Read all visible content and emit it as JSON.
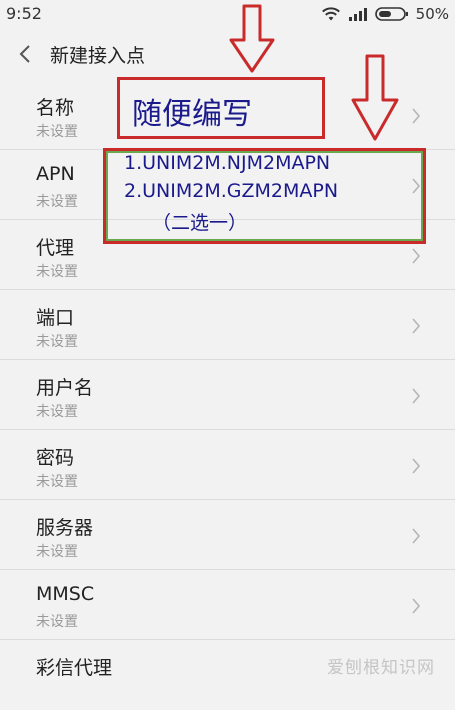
{
  "status_bar": {
    "time": "9:52",
    "battery": "50%",
    "icons": [
      "wifi-icon",
      "signal-icon",
      "battery-icon"
    ]
  },
  "app_bar": {
    "back_icon": "chevron-left-icon",
    "title": "新建接入点"
  },
  "list": {
    "items": [
      {
        "title": "名称",
        "subtitle": "未设置"
      },
      {
        "title": "APN",
        "subtitle": "未设置"
      },
      {
        "title": "代理",
        "subtitle": "未设置"
      },
      {
        "title": "端口",
        "subtitle": "未设置"
      },
      {
        "title": "用户名",
        "subtitle": "未设置"
      },
      {
        "title": "密码",
        "subtitle": "未设置"
      },
      {
        "title": "服务器",
        "subtitle": "未设置"
      },
      {
        "title": "MMSC",
        "subtitle": "未设置"
      },
      {
        "title": "彩信代理",
        "subtitle": ""
      }
    ]
  },
  "annotations": {
    "name_note": "随便编写",
    "apn_lines": [
      "1.UNIM2M.NJM2MAPN",
      "2.UNIM2M.GZM2MAPN",
      "（二选一）"
    ],
    "color": "#c92a2a",
    "text_color": "#1a1a8c"
  },
  "watermark": "爱刨根知识网"
}
